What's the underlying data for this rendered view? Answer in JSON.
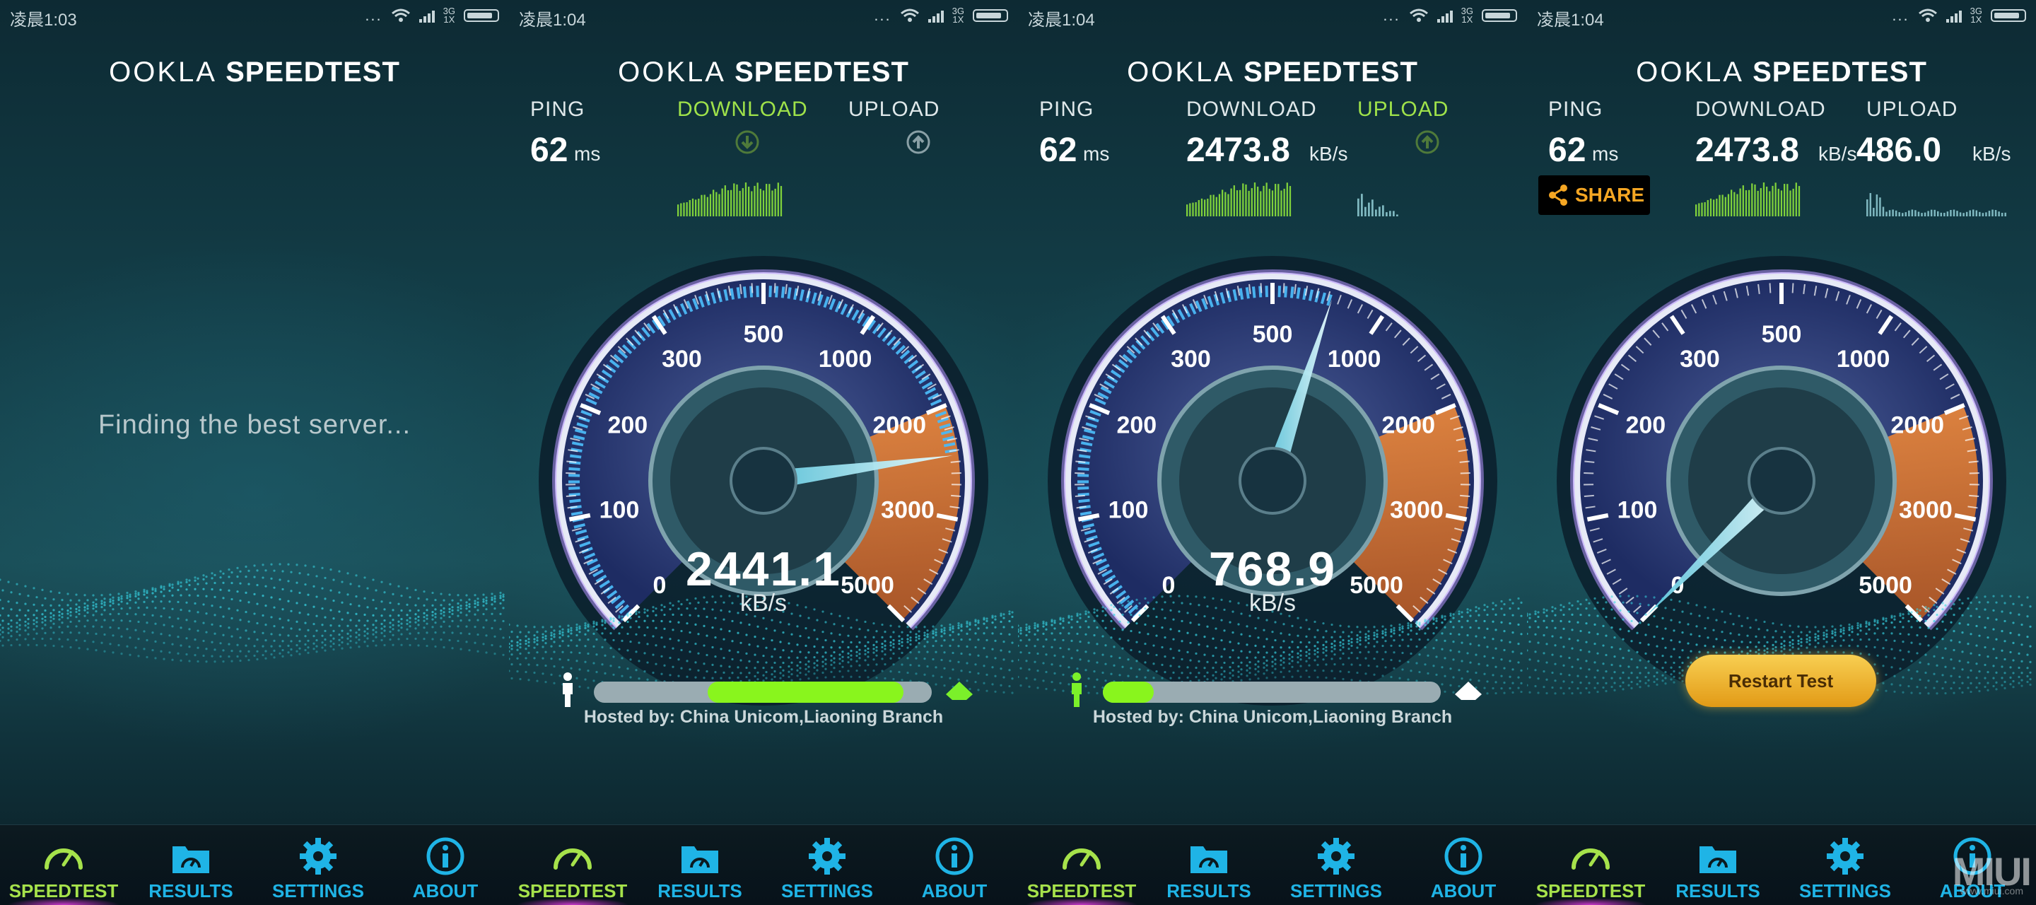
{
  "colors": {
    "active_label": "#9fe24a",
    "tab_label": "#1fb4e6",
    "progress_fill": "#89f51d",
    "share_text": "#f5a623",
    "gauge_orange": "#e5762c",
    "needle": "#bff3ff"
  },
  "panels": [
    {
      "status": {
        "time": "凌晨1:03",
        "dots": "...",
        "net_top": "3G",
        "net_bottom": "1X"
      },
      "logo": {
        "brand": "OOKLA",
        "product": "SPEEDTEST"
      },
      "message": "Finding the best server...",
      "tabs": [
        {
          "label": "SPEEDTEST",
          "icon": "speedometer-icon"
        },
        {
          "label": "RESULTS",
          "icon": "folder-gauge-icon"
        },
        {
          "label": "SETTINGS",
          "icon": "gear-icon"
        },
        {
          "label": "ABOUT",
          "icon": "info-icon"
        }
      ]
    },
    {
      "status": {
        "time": "凌晨1:04",
        "dots": "...",
        "net_top": "3G",
        "net_bottom": "1X"
      },
      "logo": {
        "brand": "OOKLA",
        "product": "SPEEDTEST"
      },
      "labels": {
        "ping": "PING",
        "download": "DOWNLOAD",
        "upload": "UPLOAD"
      },
      "ping": {
        "value": "62",
        "unit": "ms"
      },
      "gauge": {
        "value": 2441.1,
        "display": "2441.1",
        "unit": "kB/s",
        "ticks": [
          "0",
          "100",
          "200",
          "300",
          "500",
          "1000",
          "2000",
          "3000",
          "5000"
        ]
      },
      "progress": 0.58,
      "hosted": "Hosted by: China Unicom,Liaoning Branch",
      "tabs": [
        {
          "label": "SPEEDTEST",
          "icon": "speedometer-icon"
        },
        {
          "label": "RESULTS",
          "icon": "folder-gauge-icon"
        },
        {
          "label": "SETTINGS",
          "icon": "gear-icon"
        },
        {
          "label": "ABOUT",
          "icon": "info-icon"
        }
      ]
    },
    {
      "status": {
        "time": "凌晨1:04",
        "dots": "...",
        "net_top": "3G",
        "net_bottom": "1X"
      },
      "logo": {
        "brand": "OOKLA",
        "product": "SPEEDTEST"
      },
      "labels": {
        "ping": "PING",
        "download": "DOWNLOAD",
        "upload": "UPLOAD"
      },
      "ping": {
        "value": "62",
        "unit": "ms"
      },
      "download": {
        "value": "2473.8",
        "unit": "kB/s"
      },
      "gauge": {
        "value": 768.9,
        "display": "768.9",
        "unit": "kB/s",
        "ticks": [
          "0",
          "100",
          "200",
          "300",
          "500",
          "1000",
          "2000",
          "3000",
          "5000"
        ]
      },
      "progress": 0.15,
      "hosted": "Hosted by: China Unicom,Liaoning Branch",
      "tabs": [
        {
          "label": "SPEEDTEST",
          "icon": "speedometer-icon"
        },
        {
          "label": "RESULTS",
          "icon": "folder-gauge-icon"
        },
        {
          "label": "SETTINGS",
          "icon": "gear-icon"
        },
        {
          "label": "ABOUT",
          "icon": "info-icon"
        }
      ]
    },
    {
      "status": {
        "time": "凌晨1:04",
        "dots": "...",
        "net_top": "3G",
        "net_bottom": "1X"
      },
      "logo": {
        "brand": "OOKLA",
        "product": "SPEEDTEST"
      },
      "labels": {
        "ping": "PING",
        "download": "DOWNLOAD",
        "upload": "UPLOAD"
      },
      "ping": {
        "value": "62",
        "unit": "ms"
      },
      "download": {
        "value": "2473.8",
        "unit": "kB/s"
      },
      "upload": {
        "value": "486.0",
        "unit": "kB/s"
      },
      "share": "SHARE",
      "gauge": {
        "value": 0,
        "display": "",
        "unit": "",
        "ticks": [
          "0",
          "100",
          "200",
          "300",
          "500",
          "1000",
          "2000",
          "3000",
          "5000"
        ]
      },
      "restart": "Restart Test",
      "watermark": "MIUI",
      "watermark_sub": "www.miui.com",
      "tabs": [
        {
          "label": "SPEEDTEST",
          "icon": "speedometer-icon"
        },
        {
          "label": "RESULTS",
          "icon": "folder-gauge-icon"
        },
        {
          "label": "SETTINGS",
          "icon": "gear-icon"
        },
        {
          "label": "ABOUT",
          "icon": "info-icon"
        }
      ]
    }
  ]
}
